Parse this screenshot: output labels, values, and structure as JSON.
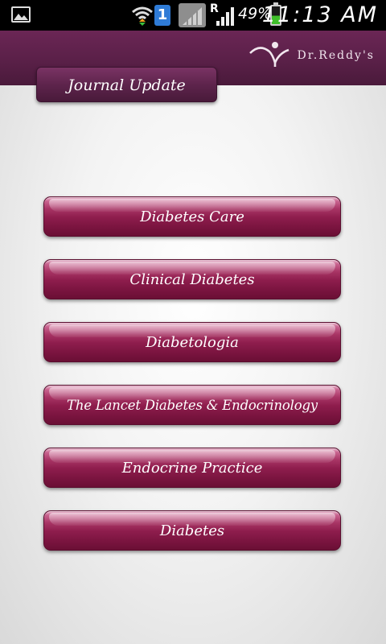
{
  "status_bar": {
    "gallery_icon": "picture-icon",
    "wifi_icon": "wifi-icon",
    "notification_count": "1",
    "no_signal_icon": "no-signal-icon",
    "roaming_indicator": "R",
    "signal_icon": "cell-signal-icon",
    "battery_percent": "49%",
    "battery_level": 0.49,
    "battery_icon": "battery-icon",
    "time": "11:13 AM"
  },
  "header": {
    "brand_logo_icon": "dr-reddys-logo-icon",
    "brand_name": "Dr.Reddy's",
    "brand_color": "#5a2048"
  },
  "section_tab": {
    "label": "Journal Update"
  },
  "journals": [
    {
      "label": "Diabetes Care"
    },
    {
      "label": "Clinical Diabetes"
    },
    {
      "label": "Diabetologia"
    },
    {
      "label": "The Lancet Diabetes & Endocrinology"
    },
    {
      "label": "Endocrine Practice"
    },
    {
      "label": "Diabetes"
    }
  ],
  "colors": {
    "button_color": "#8e1d4d",
    "header_color": "#5a2048"
  }
}
